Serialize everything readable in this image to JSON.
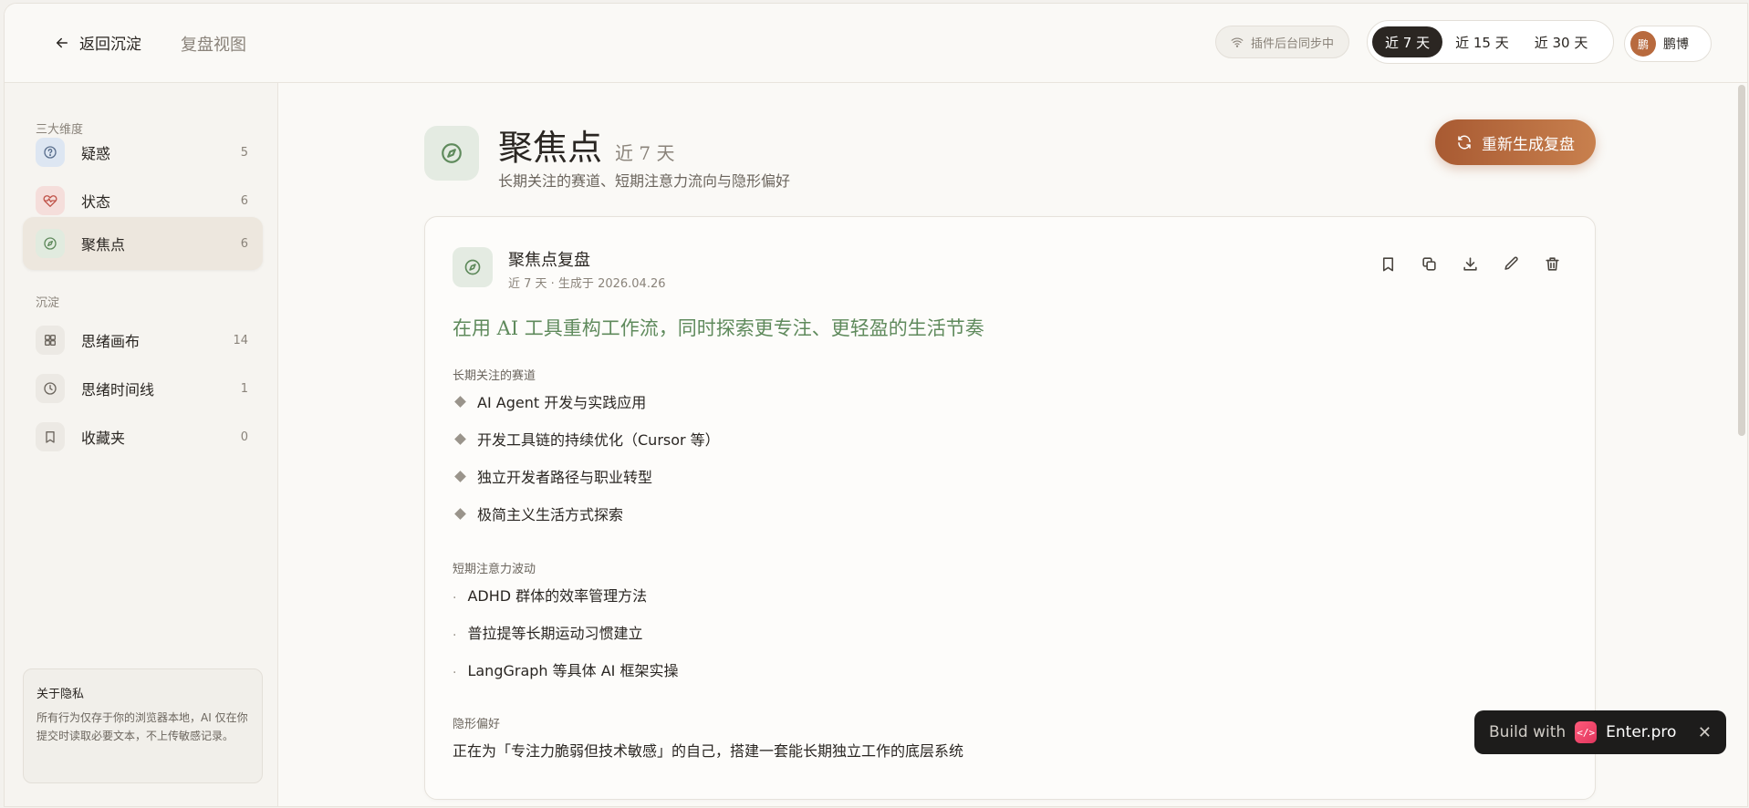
{
  "header": {
    "back_label": "返回沉淀",
    "view_title": "复盘视图",
    "sync_status": "插件后台同步中",
    "ranges": [
      "近 7 天",
      "近 15 天",
      "近 30 天"
    ],
    "active_range": 0,
    "user": {
      "avatar_text": "鹏",
      "name": "鹏博"
    }
  },
  "sidebar": {
    "section1_label": "三大维度",
    "dimensions": [
      {
        "label": "疑惑",
        "count": "5",
        "icon": "question-icon",
        "color": "#dde6f2"
      },
      {
        "label": "状态",
        "count": "6",
        "icon": "heart-pulse-icon",
        "color": "#f5dedb"
      },
      {
        "label": "聚焦点",
        "count": "6",
        "icon": "compass-icon",
        "color": "#e1ebdf"
      }
    ],
    "section2_label": "沉淀",
    "deposits": [
      {
        "label": "思绪画布",
        "count": "14",
        "icon": "grid-icon"
      },
      {
        "label": "思绪时间线",
        "count": "1",
        "icon": "clock-icon"
      },
      {
        "label": "收藏夹",
        "count": "0",
        "icon": "bookmark-icon"
      }
    ],
    "privacy": {
      "title": "关于隐私",
      "text": "所有行为仅存于你的浏览器本地，AI 仅在你提交时读取必要文本，不上传敏感记录。"
    }
  },
  "main": {
    "title": "聚焦点",
    "range": "近 7 天",
    "subtitle": "长期关注的赛道、短期注意力流向与隐形偏好",
    "regen_label": "重新生成复盘",
    "card": {
      "title": "聚焦点复盘",
      "meta": "近 7 天 · 生成于 2026.04.26",
      "headline": "在用 AI 工具重构工作流，同时探索更专注、更轻盈的生活节奏",
      "long_label": "长期关注的赛道",
      "long_items": [
        "AI Agent 开发与实践应用",
        "开发工具链的持续优化（Cursor 等）",
        "独立开发者路径与职业转型",
        "极简主义生活方式探索"
      ],
      "short_label": "短期注意力波动",
      "short_items": [
        "ADHD 群体的效率管理方法",
        "普拉提等长期运动习惯建立",
        "LangGraph 等具体 AI 框架实操"
      ],
      "hidden_label": "隐形偏好",
      "hidden_text": "正在为「专注力脆弱但技术敏感」的自己，搭建一套能长期独立工作的底层系统"
    }
  },
  "badge": {
    "prefix": "Build with",
    "brand": "Enter.pro"
  }
}
